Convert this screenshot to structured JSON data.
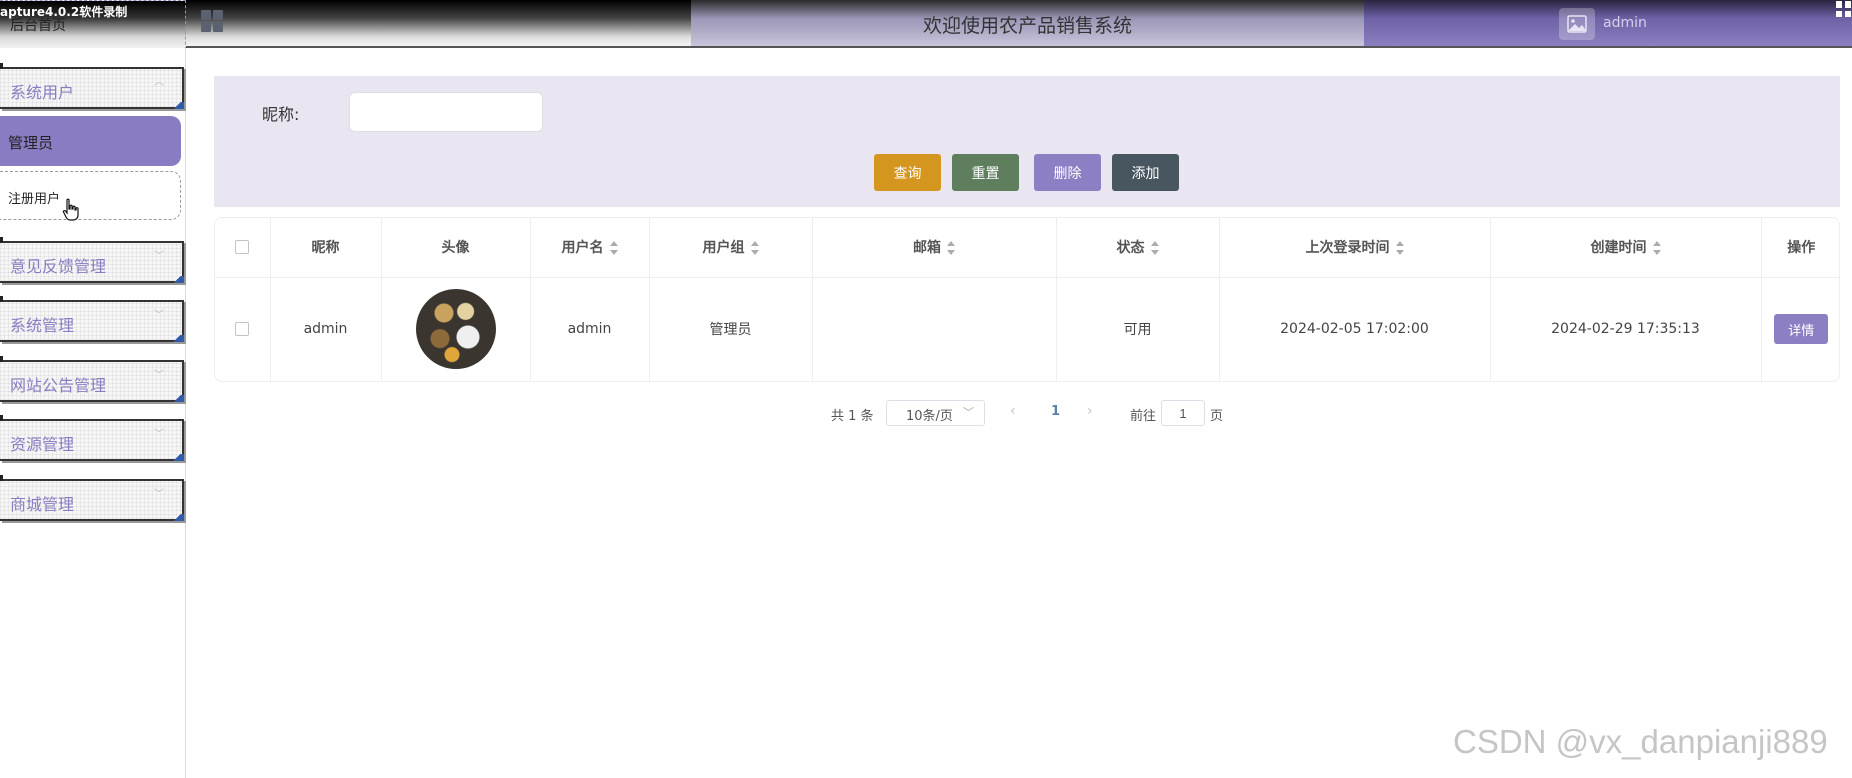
{
  "recorder": {
    "label": "apture4.0.2软件录制"
  },
  "header": {
    "home_label": "后台首页",
    "title": "欢迎使用农产品销售系统",
    "user_name": "admin"
  },
  "sidebar": {
    "groups": [
      {
        "label": "系统用户"
      },
      {
        "label": "意见反馈管理"
      },
      {
        "label": "系统管理"
      },
      {
        "label": "网站公告管理"
      },
      {
        "label": "资源管理"
      },
      {
        "label": "商城管理"
      }
    ],
    "sub_items": [
      {
        "label": "管理员",
        "active": true
      },
      {
        "label": "注册用户",
        "active": false
      }
    ]
  },
  "search": {
    "label": "昵称:",
    "value": "",
    "placeholder": ""
  },
  "actions": {
    "query": "查询",
    "reset": "重置",
    "delete": "删除",
    "add": "添加"
  },
  "table": {
    "columns": [
      "昵称",
      "头像",
      "用户名",
      "用户组",
      "邮箱",
      "状态",
      "上次登录时间",
      "创建时间",
      "操作"
    ],
    "rows": [
      {
        "nickname": "admin",
        "username": "admin",
        "group": "管理员",
        "email": "",
        "status": "可用",
        "last_login": "2024-02-05 17:02:00",
        "created": "2024-02-29 17:35:13",
        "action": "详情"
      }
    ]
  },
  "pagination": {
    "total": "共 1 条",
    "page_size": "10条/页",
    "current": "1",
    "goto_label": "前往",
    "goto_value": "1",
    "page_suffix": "页"
  },
  "watermark": "CSDN @vx_danpianji889",
  "colors": {
    "accent": "#8a7cc2",
    "query": "#d4961e",
    "reset": "#5e7e5e",
    "delete": "#8d7fc3",
    "add": "#485660"
  }
}
